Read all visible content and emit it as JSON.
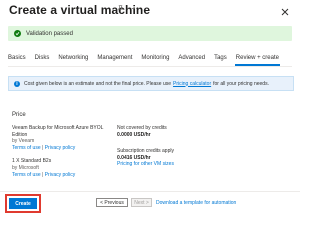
{
  "header": {
    "title": "Create a virtual machine"
  },
  "validation": {
    "message": "Validation passed"
  },
  "tabs": [
    {
      "label": "Basics"
    },
    {
      "label": "Disks"
    },
    {
      "label": "Networking"
    },
    {
      "label": "Management"
    },
    {
      "label": "Monitoring"
    },
    {
      "label": "Advanced"
    },
    {
      "label": "Tags"
    },
    {
      "label": "Review + create"
    }
  ],
  "info": {
    "text_before": "Cost given below is an estimate and not the final price. Please use",
    "link": "Pricing calculator",
    "text_after": "for all your pricing needs."
  },
  "price": {
    "section_title": "Price",
    "items": [
      {
        "name": "Veeam Backup for Microsoft Azure BYOL Edition",
        "publisher": "by Veeam",
        "terms": "Terms of use",
        "privacy": "Privacy policy",
        "credit_label": "Not covered by credits",
        "price": "0.0000 USD/hr",
        "extra_link": ""
      },
      {
        "name": "1 X Standard B2s",
        "publisher": "by Microsoft",
        "terms": "Terms of use",
        "privacy": "Privacy policy",
        "credit_label": "Subscription credits apply",
        "price": "0.0416 USD/hr",
        "extra_link": "Pricing for other VM sizes"
      }
    ]
  },
  "footer": {
    "create": "Create",
    "previous": "< Previous",
    "next": "Next >",
    "template_link": "Download a template for automation"
  }
}
